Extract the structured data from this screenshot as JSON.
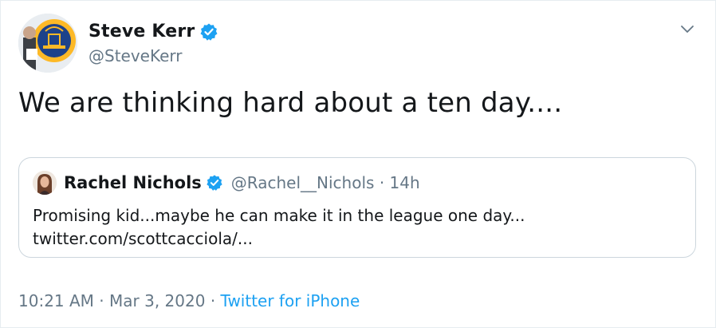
{
  "tweet": {
    "author": {
      "name": "Steve Kerr",
      "handle": "@SteveKerr",
      "avatar_icon": "golden-state-warriors-avatar"
    },
    "text": "We are thinking hard about a ten day....",
    "timestamp": "10:21 AM",
    "date": "Mar 3, 2020",
    "separator": "·",
    "source": "Twitter for iPhone"
  },
  "quoted_tweet": {
    "author": {
      "name": "Rachel Nichols",
      "handle": "@Rachel__Nichols",
      "age": "14h",
      "avatar_icon": "rachel-nichols-avatar"
    },
    "separator": "·",
    "text_line1": "Promising kid...maybe he can make it in the league one day...",
    "text_line2": "twitter.com/scottcacciola/..."
  },
  "colors": {
    "accent": "#1da1f2",
    "secondary_text": "#657786",
    "border": "#ccd6dd",
    "text": "#14171a"
  },
  "icons": [
    "verified-badge-icon",
    "chevron-down-icon"
  ]
}
